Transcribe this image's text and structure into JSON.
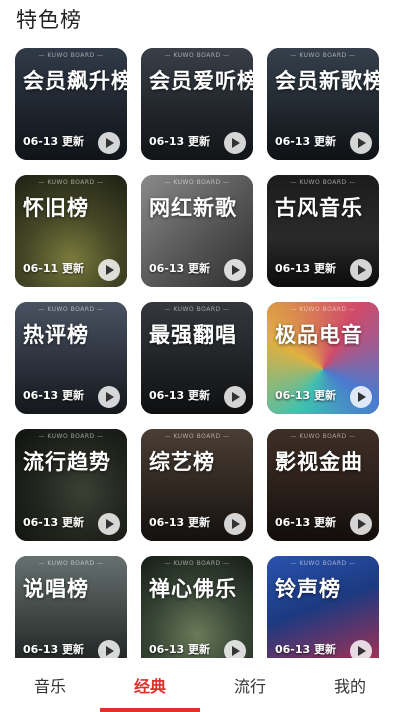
{
  "section_title": "特色榜",
  "brand": "— KUWO BOARD —",
  "cards": [
    {
      "name": "会员飙升榜",
      "date": "06-13 更新",
      "theme": "#262d38"
    },
    {
      "name": "会员爱听榜",
      "date": "06-13 更新",
      "theme": "#2b3038"
    },
    {
      "name": "会员新歌榜",
      "date": "06-13 更新",
      "theme": "#28303a"
    },
    {
      "name": "怀旧榜",
      "date": "06-11 更新",
      "theme": "#4a4a30"
    },
    {
      "name": "网红新歌",
      "date": "06-13 更新",
      "theme": "#5a5a5a"
    },
    {
      "name": "古风音乐",
      "date": "06-13 更新",
      "theme": "#1a1a1a"
    },
    {
      "name": "热评榜",
      "date": "06-13 更新",
      "theme": "#3a4250"
    },
    {
      "name": "最强翻唱",
      "date": "06-13 更新",
      "theme": "#2a2d30"
    },
    {
      "name": "极品电音",
      "date": "06-13 更新",
      "theme": "#bbbbbb"
    },
    {
      "name": "流行趋势",
      "date": "06-13 更新",
      "theme": "#252820"
    },
    {
      "name": "综艺榜",
      "date": "06-13 更新",
      "theme": "#3a3028"
    },
    {
      "name": "影视金曲",
      "date": "06-13 更新",
      "theme": "#2e2420"
    },
    {
      "name": "说唱榜",
      "date": "06-13 更新",
      "theme": "#505858"
    },
    {
      "name": "禅心佛乐",
      "date": "06-13 更新",
      "theme": "#3a4838"
    },
    {
      "name": "铃声榜",
      "date": "06-13 更新",
      "theme": "#203a78"
    }
  ],
  "tabs": [
    {
      "label": "音乐",
      "active": false
    },
    {
      "label": "经典",
      "active": true
    },
    {
      "label": "流行",
      "active": false
    },
    {
      "label": "我的",
      "active": false
    }
  ],
  "colors": {
    "accent": "#e0302a"
  }
}
